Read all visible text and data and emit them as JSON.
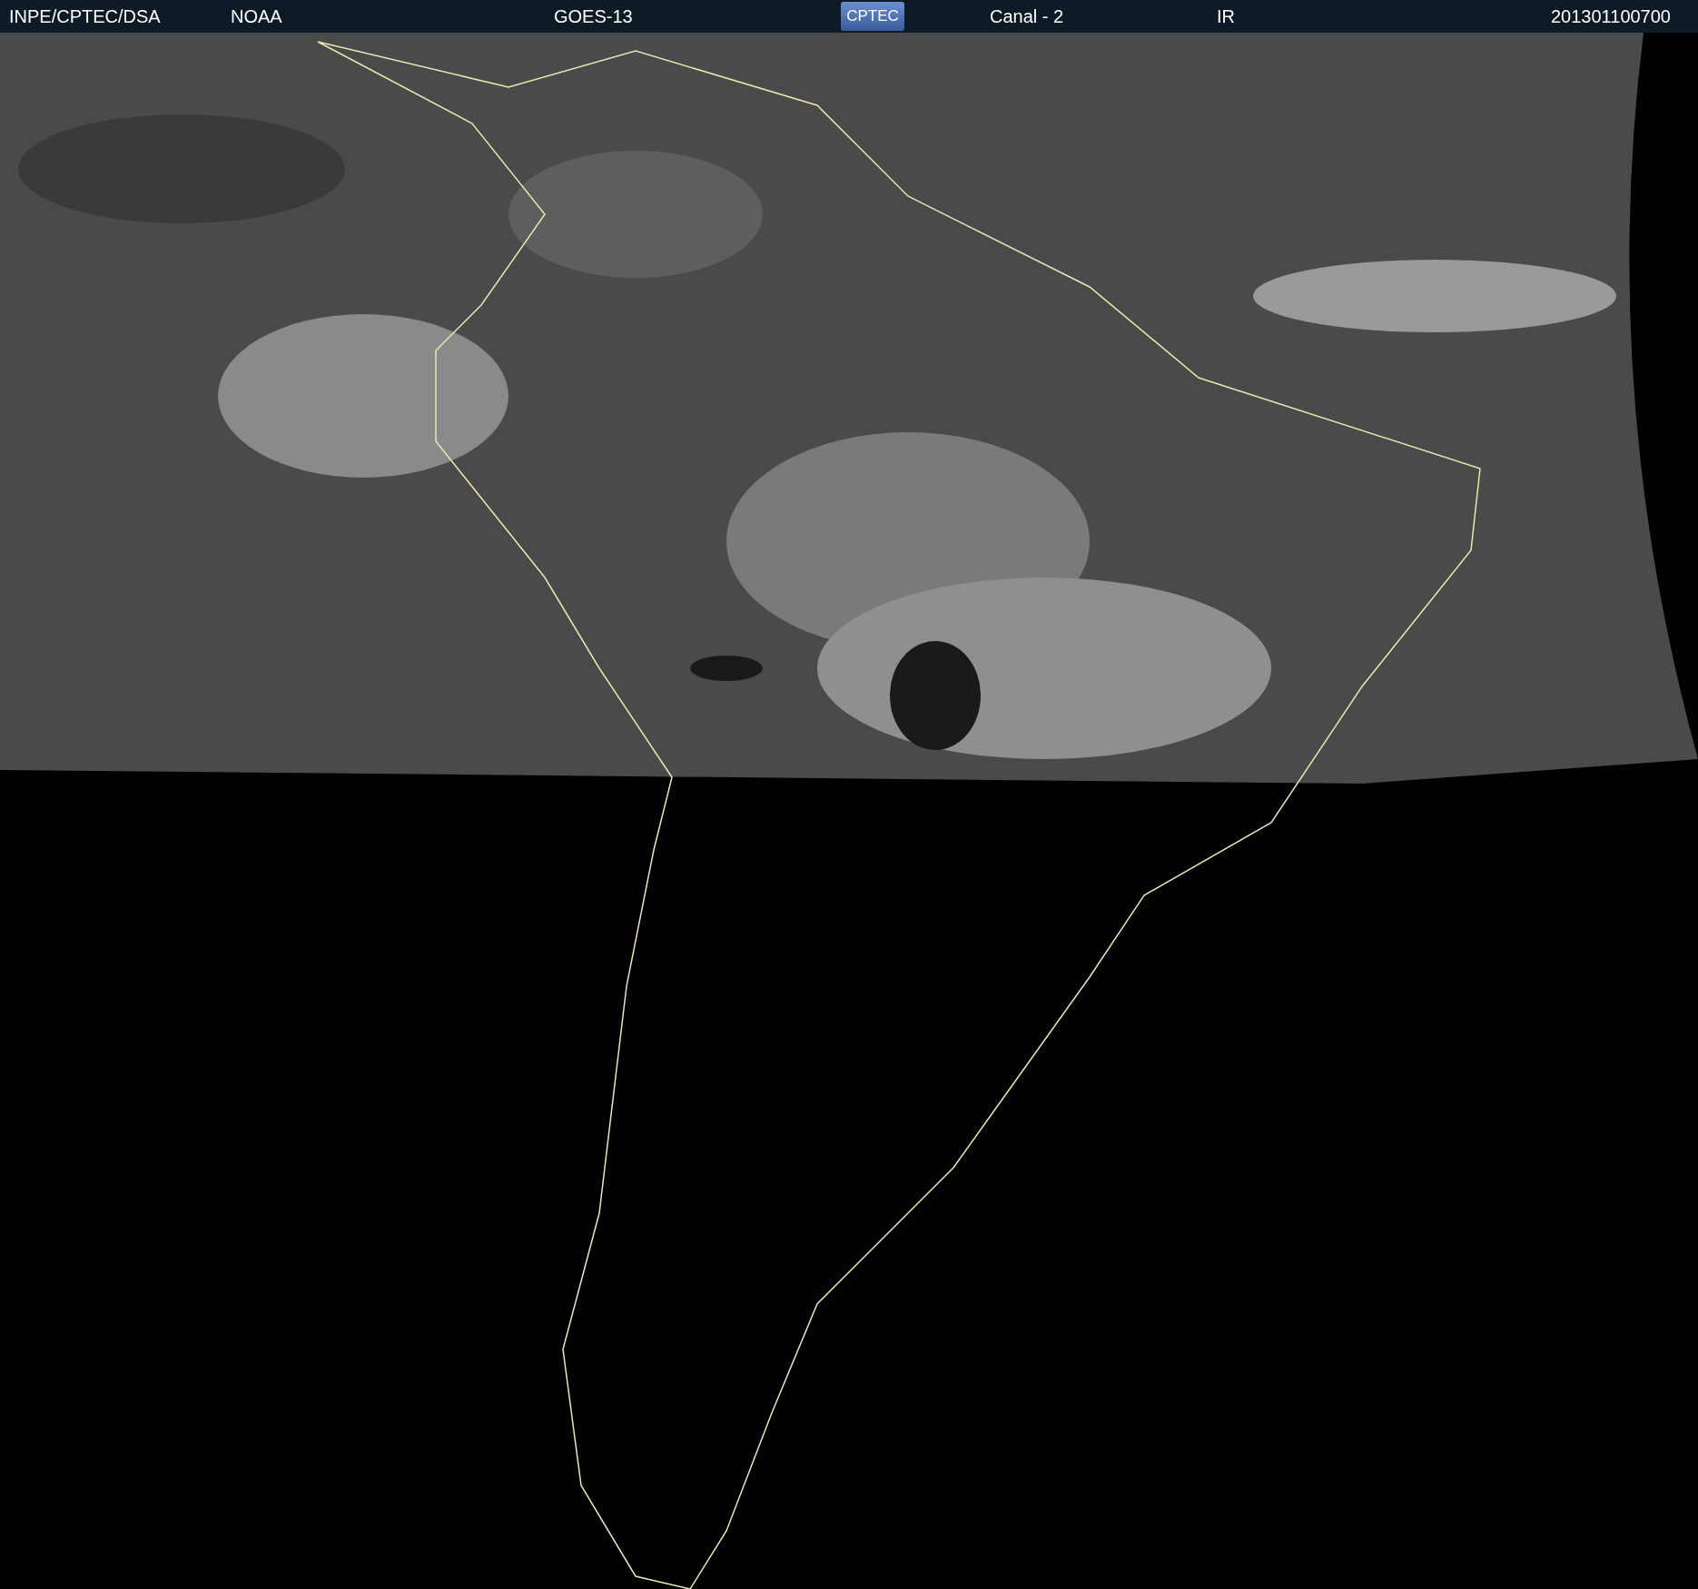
{
  "header": {
    "source": "INPE/CPTEC/DSA",
    "agency": "NOAA",
    "satellite": "GOES-13",
    "logo_text": "CPTEC",
    "channel": "Canal - 2",
    "band": "IR",
    "timestamp": "201301100700"
  }
}
